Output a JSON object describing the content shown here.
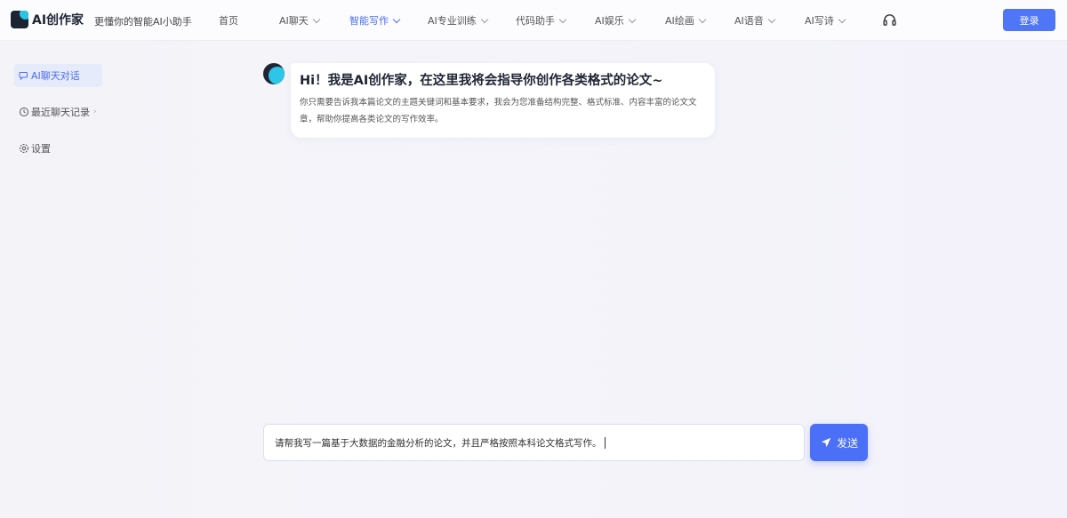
{
  "header": {
    "logo_text": "AI创作家",
    "slogan": "更懂你的智能AI小助手",
    "nav": [
      {
        "label": "首页",
        "has_dropdown": false,
        "active": false
      },
      {
        "label": "AI聊天",
        "has_dropdown": true,
        "active": false
      },
      {
        "label": "智能写作",
        "has_dropdown": true,
        "active": true
      },
      {
        "label": "AI专业训练",
        "has_dropdown": true,
        "active": false
      },
      {
        "label": "代码助手",
        "has_dropdown": true,
        "active": false
      },
      {
        "label": "AI娱乐",
        "has_dropdown": true,
        "active": false
      },
      {
        "label": "AI绘画",
        "has_dropdown": true,
        "active": false
      },
      {
        "label": "AI语音",
        "has_dropdown": true,
        "active": false
      },
      {
        "label": "AI写诗",
        "has_dropdown": true,
        "active": false
      }
    ],
    "support_icon": "headset-icon",
    "login_label": "登录"
  },
  "sidebar": {
    "items": [
      {
        "label": "AI聊天对话",
        "icon": "chat-bubble-icon",
        "active": true
      },
      {
        "label": "最近聊天记录",
        "icon": "clock-icon",
        "active": false,
        "has_arrow": true
      },
      {
        "label": "设置",
        "icon": "gear-icon",
        "active": false
      }
    ]
  },
  "chat": {
    "greeting_title": "Hi！我是AI创作家，在这里我将会指导你创作各类格式的论文~",
    "greeting_body": "你只需要告诉我本篇论文的主题关键词和基本要求，我会为您准备结构完整、格式标准、内容丰富的论文文章，帮助你提高各类论文的写作效率。"
  },
  "composer": {
    "input_value": "请帮我写一篇基于大数据的金融分析的论文，并且严格按照本科论文格式写作。",
    "send_label": "发送"
  },
  "colors": {
    "accent": "#4b6ff6",
    "active_nav": "#4a6cf7",
    "logo_dark": "#1c2333",
    "logo_cyan": "#29c4e6"
  }
}
